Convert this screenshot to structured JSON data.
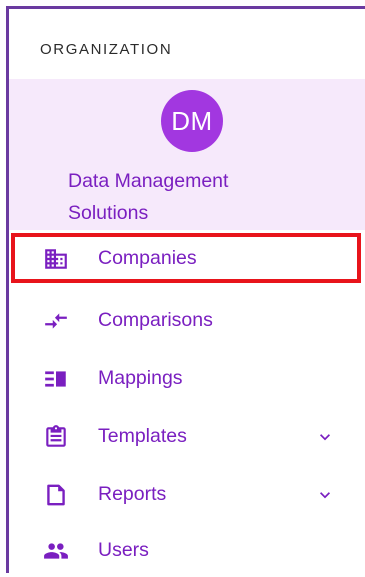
{
  "sidebar": {
    "section_heading": "ORGANIZATION",
    "org": {
      "initials": "DM",
      "name": "Data Management Solutions"
    },
    "items": [
      {
        "label": "Companies",
        "icon": "building-icon",
        "selected": true,
        "expandable": false
      },
      {
        "label": "Comparisons",
        "icon": "compare-arrows-icon",
        "selected": false,
        "expandable": false
      },
      {
        "label": "Mappings",
        "icon": "mapping-icon",
        "selected": false,
        "expandable": false
      },
      {
        "label": "Templates",
        "icon": "clipboard-icon",
        "selected": false,
        "expandable": true
      },
      {
        "label": "Reports",
        "icon": "report-icon",
        "selected": false,
        "expandable": true
      },
      {
        "label": "Users",
        "icon": "users-icon",
        "selected": false,
        "expandable": false
      }
    ]
  },
  "colors": {
    "accent": "#7a1fc0",
    "avatar": "#a237e0",
    "org_card_bg": "#f6e9fb",
    "highlight_border": "#e8141b"
  }
}
